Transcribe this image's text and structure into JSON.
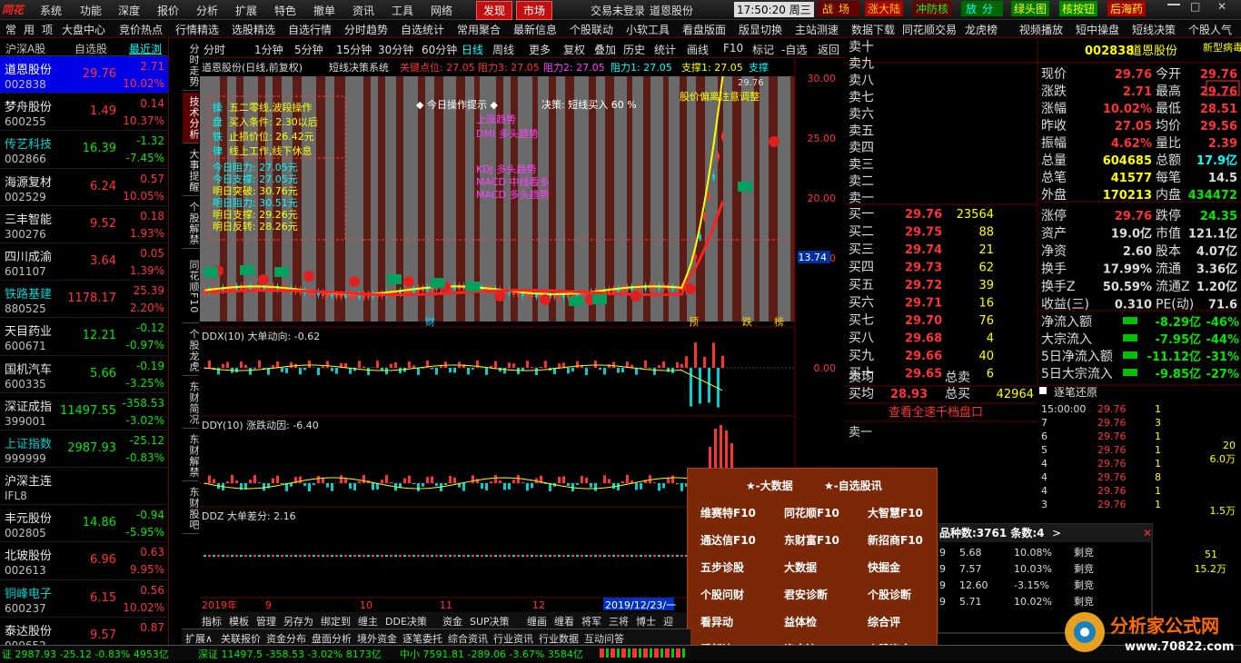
{
  "topbar": {
    "menus": [
      "系统",
      "功能",
      "深度",
      "报价",
      "分析",
      "扩展",
      "特色",
      "撤单",
      "资讯",
      "工具",
      "网络"
    ],
    "btn_faxian": "发现",
    "btn_shichang": "市场",
    "login_status": "交易未登录",
    "login_stock": "道恩股份",
    "time": "17:50:20",
    "weekday": "周三",
    "quick": [
      "战场",
      "涨大陆",
      "冲防核",
      "放分",
      "绿头图",
      "核按钮",
      "后海药"
    ]
  },
  "menubar": {
    "items": [
      "常",
      "用",
      "项",
      "大盘中心",
      "竞价热点",
      "行情精选",
      "选股精选",
      "自选行情",
      "分时趋势",
      "自选统计",
      "常用聚合",
      "最新信息",
      "个股联动",
      "小软工具",
      "看盘版面",
      "版显切换",
      "主站测速",
      "数据下载",
      "同花顺交易",
      "龙虎榜",
      "视频播放",
      "短中操盘",
      "短线决策",
      "个股人气"
    ]
  },
  "stocklist": {
    "tabs": [
      "沪深A股",
      "自选股",
      "最近浏览"
    ],
    "rows": [
      {
        "name": "道恩股份",
        "code": "002838",
        "price": "29.76",
        "chg": "2.71",
        "pct": "10.02%",
        "dir": "up"
      },
      {
        "name": "梦舟股份",
        "code": "600255",
        "price": "1.49",
        "chg": "0.14",
        "pct": "10.37%",
        "dir": "up"
      },
      {
        "name": "传艺科技",
        "code": "002866",
        "price": "16.39",
        "chg": "-1.32",
        "pct": "-7.45%",
        "dir": "down"
      },
      {
        "name": "海源复材",
        "code": "002529",
        "price": "6.24",
        "chg": "0.57",
        "pct": "10.05%",
        "dir": "up"
      },
      {
        "name": "三丰智能",
        "code": "300276",
        "price": "9.52",
        "chg": "0.18",
        "pct": "1.93%",
        "dir": "up"
      },
      {
        "name": "四川成渝",
        "code": "601107",
        "price": "3.64",
        "chg": "0.05",
        "pct": "1.39%",
        "dir": "up"
      },
      {
        "name": "铁路基建",
        "code": "880525",
        "price": "1178.17",
        "chg": "25.39",
        "pct": "2.20%",
        "dir": "up"
      },
      {
        "name": "天目药业",
        "code": "600671",
        "price": "12.21",
        "chg": "-0.12",
        "pct": "-0.97%",
        "dir": "down"
      },
      {
        "name": "国机汽车",
        "code": "600335",
        "price": "5.66",
        "chg": "-0.19",
        "pct": "-3.25%",
        "dir": "down"
      },
      {
        "name": "深证成指",
        "code": "399001",
        "price": "11497.55",
        "chg": "-358.53",
        "pct": "-3.02%",
        "dir": "down"
      },
      {
        "name": "上证指数",
        "code": "999999",
        "price": "2987.93",
        "chg": "-25.12",
        "pct": "-0.83%",
        "dir": "down"
      },
      {
        "name": "沪深主连",
        "code": "IFL8",
        "price": "",
        "chg": "",
        "pct": "",
        "dir": "none"
      },
      {
        "name": "丰元股份",
        "code": "002805",
        "price": "14.86",
        "chg": "-0.94",
        "pct": "-5.95%",
        "dir": "down"
      },
      {
        "name": "北玻股份",
        "code": "002613",
        "price": "6.96",
        "chg": "0.63",
        "pct": "9.95%",
        "dir": "up"
      },
      {
        "name": "铜峰电子",
        "code": "600237",
        "price": "6.15",
        "chg": "0.56",
        "pct": "10.02%",
        "dir": "up"
      },
      {
        "name": "泰达股份",
        "code": "000652",
        "price": "9.57",
        "chg": "0.87",
        "pct": "",
        "dir": "up"
      }
    ]
  },
  "vtabs": [
    "分时走势",
    "技术分析",
    "大事提醒",
    "个股解禁",
    "同花顺F10",
    "个股龙虎",
    "东财简况",
    "东财解禁",
    "东财股吧"
  ],
  "periodbar": [
    "分时",
    "1分钟",
    "5分钟",
    "15分钟",
    "30分钟",
    "60分钟",
    "日线",
    "周线",
    "更多",
    "复权",
    "叠加",
    "历史",
    "统计",
    "画线",
    "F10",
    "标记",
    "-自选",
    "返回"
  ],
  "main": {
    "title": "道恩股份(日线,前复权)",
    "system": "短线决策系统",
    "keypoints": "关键点位: 27.05",
    "r3": "阻力3: 27.05",
    "r2": "阻力2: 27.05",
    "r1": "阻力1: 27.05",
    "s1": "支撑1: 27.05",
    "s_label": "支撑",
    "ops": [
      "操",
      "盘",
      "铁",
      "律"
    ],
    "ops_text": [
      "五二零线,波段操作",
      "买入条件: 2.30以后",
      "止损价位: 26.42元",
      "线上工作,线下休息"
    ],
    "levels": [
      "今日阻力: 27.05元",
      "今日支撑: 27.05元",
      "明日突破: 30.76元",
      "明日阻力: 30.51元",
      "明日支撑: 29.26元",
      "明日反转: 28.26元"
    ],
    "prompt": "◆ 今日操作提示 ◆",
    "decision": "决策: 短线买入 60 %",
    "warn": "股价偏离注意调整",
    "trend": "上涨趋势",
    "dmi": "DMI 多头趋势",
    "kdj": "KDJ 多头趋势",
    "macd1": "MACD 中线看多",
    "macd2": "MACD 多头趋势",
    "price_high": "29.76",
    "cur_price": "13.74",
    "yaxis": [
      "30.00",
      "25.00",
      "20.00",
      "15.00"
    ],
    "marks": [
      "财",
      "预",
      "跌",
      "榜"
    ],
    "ddx": "DDX(10) 大单动向: -0.62",
    "ddx_axis": "0.00",
    "ddy": "DDY(10) 涨跌动因: -6.40",
    "ddz": "DDZ 大单差分: 2.16",
    "dates": [
      "2019年",
      "9",
      "10",
      "11",
      "12",
      "2019/12/23/一"
    ]
  },
  "quote": {
    "code": "002838",
    "name": "道恩股份",
    "tag": "新型病毒防",
    "sells": [
      "卖十",
      "卖九",
      "卖八",
      "卖七",
      "卖六",
      "卖五",
      "卖四",
      "卖三",
      "卖二",
      "卖一"
    ],
    "buys": [
      {
        "l": "买一",
        "p": "29.76",
        "v": "23564"
      },
      {
        "l": "买二",
        "p": "29.75",
        "v": "88"
      },
      {
        "l": "买三",
        "p": "29.74",
        "v": "21"
      },
      {
        "l": "买四",
        "p": "29.73",
        "v": "62"
      },
      {
        "l": "买五",
        "p": "29.72",
        "v": "39"
      },
      {
        "l": "买六",
        "p": "29.71",
        "v": "16"
      },
      {
        "l": "买七",
        "p": "29.70",
        "v": "76"
      },
      {
        "l": "买八",
        "p": "29.68",
        "v": "4"
      },
      {
        "l": "买九",
        "p": "29.66",
        "v": "40"
      },
      {
        "l": "买十",
        "p": "29.65",
        "v": "6"
      }
    ],
    "avg_sell": "卖均",
    "avg_buy": "买均",
    "avg_buy_v": "28.93",
    "total_sell": "总卖",
    "total_buy": "总买",
    "total_buy_v": "42964",
    "full_link": "查看全速千档盘口",
    "sell1": "卖一",
    "stats": [
      [
        "现价",
        "29.76",
        "今开",
        "29.76"
      ],
      [
        "涨跌",
        "2.71",
        "最高",
        "29.76"
      ],
      [
        "涨幅",
        "10.02%",
        "最低",
        "28.51"
      ],
      [
        "昨收",
        "27.05",
        "均价",
        "29.56"
      ],
      [
        "振幅",
        "4.62%",
        "量比",
        "2.39"
      ],
      [
        "总量",
        "604685",
        "总额",
        "17.9亿"
      ],
      [
        "总笔",
        "41577",
        "每笔",
        "14.5"
      ],
      [
        "外盘",
        "170213",
        "内盘",
        "434472"
      ]
    ],
    "stats2": [
      [
        "涨停",
        "29.76",
        "跌停",
        "24.35"
      ],
      [
        "资产",
        "19.0亿",
        "市值",
        "121.1亿"
      ],
      [
        "净资",
        "2.60",
        "股本",
        "4.07亿"
      ],
      [
        "换手",
        "17.99%",
        "流通",
        "3.36亿"
      ],
      [
        "换手Z",
        "50.59%",
        "流通Z",
        "1.20亿"
      ],
      [
        "收益(三)",
        "0.310",
        "PE(动)",
        "71.6"
      ]
    ],
    "flows": [
      [
        "净流入额",
        "-8.29亿",
        "-46%"
      ],
      [
        "大宗流入",
        "-7.95亿",
        "-44%"
      ],
      [
        "5日净流入额",
        "-11.12亿",
        "-31%"
      ],
      [
        "5日大宗流入",
        "-9.85亿",
        "-27%"
      ]
    ],
    "ticks_title": "逐笔还原",
    "ticks": [
      [
        "15:00:00",
        "29.76",
        "1"
      ],
      [
        "7",
        "29.76",
        "3"
      ],
      [
        "6",
        "29.76",
        "1"
      ],
      [
        "5",
        "29.76",
        "1"
      ],
      [
        "4",
        "29.76",
        "1"
      ],
      [
        "4",
        "29.76",
        "8"
      ],
      [
        "4",
        "29.76",
        "1"
      ],
      [
        "3",
        "29.76",
        "1"
      ]
    ],
    "side_vol": [
      "20",
      "6.0万",
      "1.5万"
    ],
    "small_title": "品种数:3761 条数:4",
    "small_rows": [
      [
        "9",
        "5.68",
        "10.08%",
        "剩竞"
      ],
      [
        "9",
        "7.57",
        "10.03%",
        "剩竞"
      ],
      [
        "9",
        "12.60",
        "-3.15%",
        "剩竞"
      ],
      [
        "9",
        "5.71",
        "10.02%",
        "剩竞"
      ]
    ],
    "small_side": [
      "51",
      "15.2万"
    ]
  },
  "popup": {
    "row1": [
      "★-大数据",
      "★-自选股讯"
    ],
    "items": [
      "维赛特F10",
      "同花顺F10",
      "大智慧F10",
      "通达信F10",
      "东财富F10",
      "新招商F10",
      "五步诊股",
      "大数据",
      "快掘金",
      "个股问财",
      "君安诊断",
      "个股诊断",
      "看异动",
      "益体检",
      "综合评",
      "看新浪",
      "资金流",
      "个股资金"
    ]
  },
  "bottomtabs": [
    "扩展∧",
    "关联报价",
    "资金分布",
    "盘面分析",
    "境外资金",
    "逐笔委托",
    "综合资讯",
    "行业资讯",
    "行业数据",
    "互动问答"
  ],
  "indtabs": [
    "指标",
    "模板",
    "管理",
    "另存为",
    "绑定到",
    "缠主",
    "DDE决策",
    "资金",
    "SUP决策",
    "缠画",
    "缠看",
    "将军",
    "三将",
    "博士",
    "迎"
  ],
  "status": {
    "sh": "证 2987.93 -25.12 -0.83% 4953亿",
    "sz": "深证 11497.5 -358.53 -3.02% 8173亿",
    "zx": "中小 7591.81 -289.06 -3.67% 3584亿"
  },
  "logo": {
    "text": "分析家公式网",
    "url_text": "www.70822.com"
  },
  "colors": {
    "up": "#ff3232",
    "down": "#00e600",
    "chart_bg": "#5a1c14",
    "band": "#6a6a6a"
  }
}
